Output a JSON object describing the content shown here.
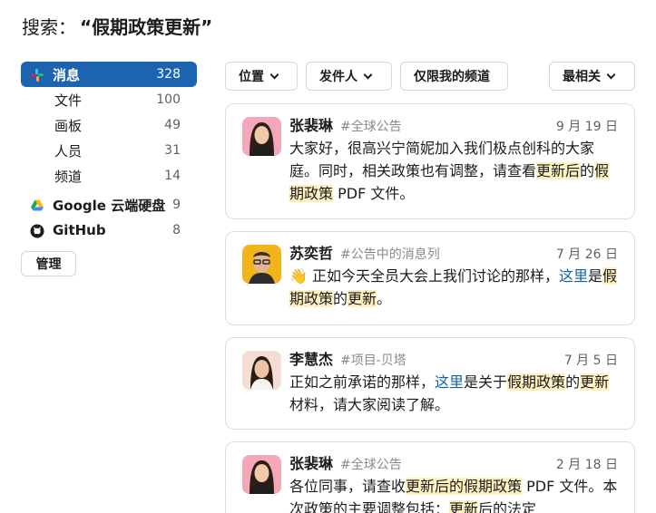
{
  "search": {
    "label": "搜索：",
    "query": "“假期政策更新”"
  },
  "sidebar": {
    "items": [
      {
        "label": "消息",
        "count": "328",
        "icon": "slack-icon",
        "active": true
      },
      {
        "label": "文件",
        "count": "100"
      },
      {
        "label": "画板",
        "count": "49"
      },
      {
        "label": "人员",
        "count": "31"
      },
      {
        "label": "频道",
        "count": "14"
      },
      {
        "label": "Google 云端硬盘",
        "count": "9",
        "icon": "google-drive-icon"
      },
      {
        "label": "GitHub",
        "count": "8",
        "icon": "github-icon"
      }
    ],
    "manage_label": "管理"
  },
  "filters": {
    "location": "位置",
    "sender": "发件人",
    "my_channels": "仅限我的频道",
    "sort": "最相关"
  },
  "results": [
    {
      "author": "张裴琳",
      "channel": "#全球公告",
      "date": "9 月 19 日",
      "segments": [
        {
          "t": "大家好，很高兴宁简妮加入我们极点创科的大家庭。同时，相关政策也有调整，请查看"
        },
        {
          "t": "更新",
          "hl": true
        },
        {
          "t": "后",
          "hl": true
        },
        {
          "t": "的"
        },
        {
          "t": "假期政策",
          "hl": true
        },
        {
          "t": " PDF 文件。"
        }
      ]
    },
    {
      "author": "苏奕哲",
      "channel": "#公告中的消息列",
      "date": "7 月 26 日",
      "segments": [
        {
          "t": "👋 正如今天全员大会上我们讨论的那样，"
        },
        {
          "t": "这里",
          "link": true
        },
        {
          "t": "是"
        },
        {
          "t": "假期政策",
          "hl": true
        },
        {
          "t": "的"
        },
        {
          "t": "更新",
          "hl": true
        },
        {
          "t": "。"
        }
      ]
    },
    {
      "author": "李慧杰",
      "channel": "#项目-贝塔",
      "date": "7 月 5 日",
      "segments": [
        {
          "t": "正如之前承诺的那样，"
        },
        {
          "t": "这里",
          "link": true
        },
        {
          "t": "是关于"
        },
        {
          "t": "假期政策",
          "hl": true
        },
        {
          "t": "的"
        },
        {
          "t": "更新",
          "hl": true
        },
        {
          "t": "材料，请大家阅读了解。"
        }
      ]
    },
    {
      "author": "张裴琳",
      "channel": "#全球公告",
      "date": "2 月 18 日",
      "segments": [
        {
          "t": "各位同事，请查收"
        },
        {
          "t": "更新后的假期政策",
          "hl": true
        },
        {
          "t": " PDF 文件。本次政策的主要调整包括："
        },
        {
          "t": "更新",
          "hl": true
        },
        {
          "t": "后的法定"
        }
      ]
    }
  ],
  "colors": {
    "accent": "#1d64b0",
    "highlight": "#fdf1c0",
    "link": "#1264a3"
  }
}
